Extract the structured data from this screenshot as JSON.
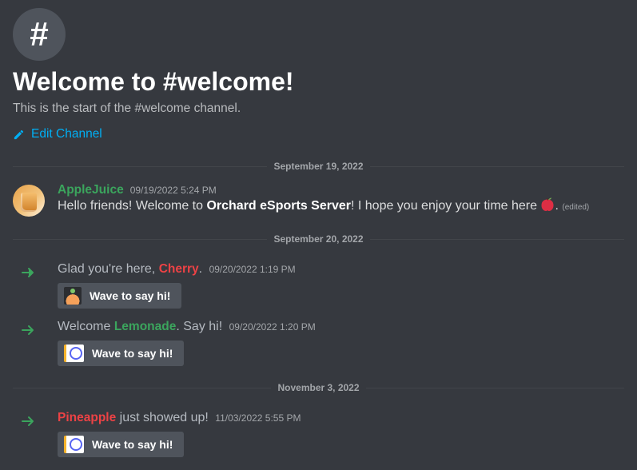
{
  "header": {
    "icon": "hash-icon",
    "title": "Welcome to #welcome!",
    "subtitle": "This is the start of the #welcome channel.",
    "edit_label": "Edit Channel"
  },
  "dividers": {
    "d1": "September 19, 2022",
    "d2": "September 20, 2022",
    "d3": "November 3, 2022"
  },
  "messages": {
    "m1": {
      "author": "AppleJuice",
      "timestamp": "09/19/2022 5:24 PM",
      "text_pre": "Hello friends! Welcome to ",
      "server_name": "Orchard eSports Server",
      "text_post": "! I hope you enjoy your time here ",
      "period": ".",
      "edited": "(edited)"
    }
  },
  "system": {
    "s1": {
      "pre": "Glad you're here, ",
      "name": "Cherry",
      "post": ".",
      "timestamp": "09/20/2022 1:19 PM",
      "wave": "Wave to say hi!"
    },
    "s2": {
      "pre": "Welcome ",
      "name": "Lemonade",
      "post": ". Say hi!",
      "timestamp": "09/20/2022 1:20 PM",
      "wave": "Wave to say hi!"
    },
    "s3": {
      "pre": "",
      "name": "Pineapple",
      "post": " just showed up!",
      "timestamp": "11/03/2022 5:55 PM",
      "wave": "Wave to say hi!"
    }
  }
}
